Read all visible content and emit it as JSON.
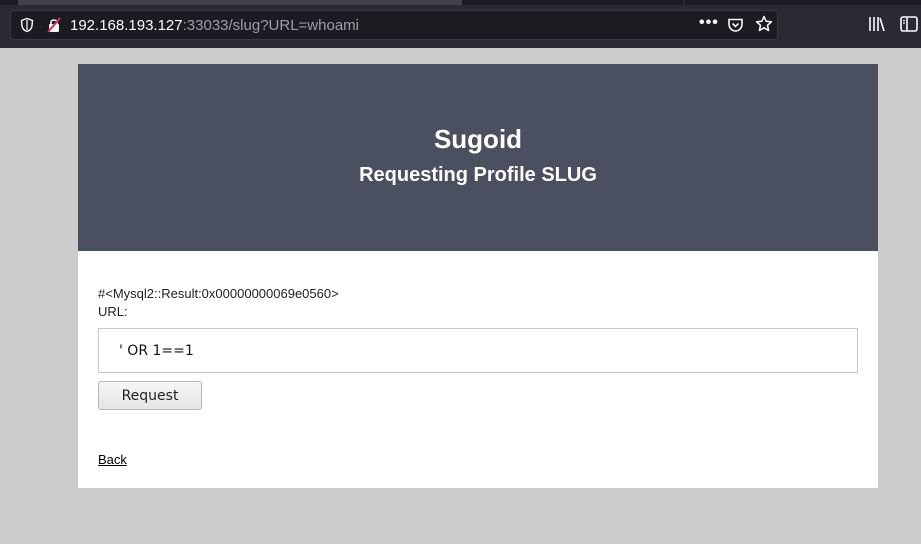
{
  "browser": {
    "url_host": "192.168.193.127",
    "url_rest": ":33033/slug?URL=whoami",
    "icons": [
      "shield-icon",
      "insecure-lock-icon",
      "more-icon",
      "pocket-icon",
      "star-icon",
      "library-icon",
      "sidebar-icon"
    ],
    "more_glyph": "•••"
  },
  "page": {
    "title": "Sugoid",
    "subtitle": "Requesting Profile SLUG",
    "result": "#<Mysql2::Result:0x00000000069e0560>",
    "url_label": "URL:",
    "url_value": "' OR 1==1",
    "request_label": "Request",
    "back_label": "Back"
  },
  "colors": {
    "hero_bg": "#4a5060",
    "page_bg": "#cccccc",
    "toolbar_bg": "#2b2a33"
  }
}
